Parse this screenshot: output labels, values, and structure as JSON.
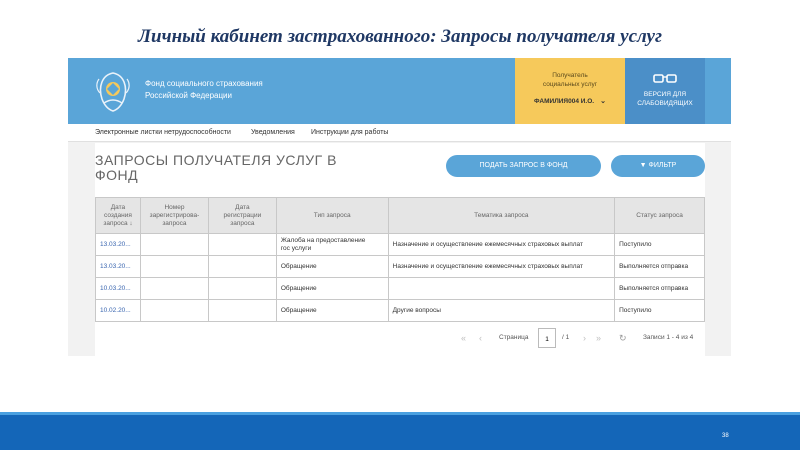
{
  "slide": {
    "title": "Личный кабинет застрахованного: Запросы получателя услуг",
    "number": "38"
  },
  "header": {
    "org_line1": "Фонд социального страхования",
    "org_line2": "Российской Федерации",
    "recipient_line1": "Получатель",
    "recipient_line2": "социальных услуг",
    "recipient_user": "ФАМИЛИЯ004 И.О.",
    "low_vision_line1": "ВЕРСИЯ ДЛЯ",
    "low_vision_line2": "СЛАБОВИДЯЩИХ"
  },
  "nav": {
    "items": [
      "Электронные листки нетрудоспособности",
      "Уведомления",
      "Инструкции для работы"
    ]
  },
  "page": {
    "heading_line1": "ЗАПРОСЫ ПОЛУЧАТЕЛЯ УСЛУГ В",
    "heading_line2": "ФОНД",
    "submit_button": "ПОДАТЬ ЗАПРОС В ФОНД",
    "filter_button": "ФИЛЬТР"
  },
  "table": {
    "columns": [
      {
        "l1": "Дата",
        "l2": "создания",
        "l3": "запроса ↓"
      },
      {
        "l1": "Номер",
        "l2": "зарегистрирова-",
        "l3": "запроса"
      },
      {
        "l1": "Дата",
        "l2": "регистрации",
        "l3": "запроса"
      },
      {
        "l1": "Тип запроса",
        "l2": "",
        "l3": ""
      },
      {
        "l1": "Тематика запроса",
        "l2": "",
        "l3": ""
      },
      {
        "l1": "Статус запроса",
        "l2": "",
        "l3": ""
      }
    ],
    "rows": [
      {
        "date": "13.03.20...",
        "number": "",
        "reg_date": "",
        "type_l1": "Жалоба на предоставление",
        "type_l2": "гос услуги",
        "topic": "Назначение и осуществление ежемесячных страховых выплат",
        "status": "Поступило"
      },
      {
        "date": "13.03.20...",
        "number": "",
        "reg_date": "",
        "type_l1": "Обращение",
        "type_l2": "",
        "topic": "Назначение и осуществление ежемесячных страховых выплат",
        "status": "Выполняется отправка"
      },
      {
        "date": "10.03.20...",
        "number": "",
        "reg_date": "",
        "type_l1": "Обращение",
        "type_l2": "",
        "topic": "",
        "status": "Выполняется отправка"
      },
      {
        "date": "10.02.20...",
        "number": "",
        "reg_date": "",
        "type_l1": "Обращение",
        "type_l2": "",
        "topic": "Другие вопросы",
        "status": "Поступило"
      }
    ]
  },
  "pager": {
    "page_label": "Страница",
    "page_value": "1",
    "page_total": "/ 1",
    "records": "Записи 1 - 4 из 4"
  }
}
